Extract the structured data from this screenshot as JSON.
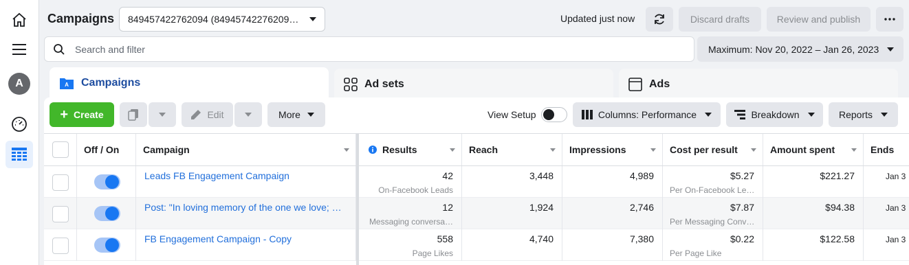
{
  "header": {
    "title": "Campaigns",
    "account_select": "849457422762094 (84945742276209…",
    "updated_status": "Updated just now",
    "discard_label": "Discard drafts",
    "review_label": "Review and publish",
    "more_icon": "ellipsis-icon"
  },
  "search": {
    "placeholder": "Search and filter",
    "icon": "search-icon"
  },
  "date_range": {
    "label": "Maximum: Nov 20, 2022 – Jan 26, 2023"
  },
  "rail": {
    "avatar_letter": "A",
    "icons": [
      "home-icon",
      "menu-icon",
      "avatar",
      "gauge-icon",
      "table-icon"
    ]
  },
  "tabs": [
    {
      "label": "Campaigns",
      "icon": "folder-icon",
      "active": true
    },
    {
      "label": "Ad sets",
      "icon": "grid-icon",
      "active": false
    },
    {
      "label": "Ads",
      "icon": "ad-icon",
      "active": false
    }
  ],
  "toolbar": {
    "create_label": "Create",
    "edit_label": "Edit",
    "more_label": "More",
    "view_setup_label": "View Setup",
    "columns_label": "Columns: Performance",
    "breakdown_label": "Breakdown",
    "reports_label": "Reports"
  },
  "table": {
    "columns": [
      "Off / On",
      "Campaign",
      "Results",
      "Reach",
      "Impressions",
      "Cost per result",
      "Amount spent",
      "Ends"
    ],
    "rows": [
      {
        "name": "Leads FB Engagement Campaign",
        "results": "42",
        "results_sub": "On-Facebook Leads",
        "reach": "3,448",
        "impressions": "4,989",
        "cost": "$5.27",
        "cost_sub": "Per On-Facebook Le…",
        "spent": "$221.27",
        "ends": "Jan 3"
      },
      {
        "name": "Post: \"In loving memory of the one we love; m…",
        "results": "12",
        "results_sub": "Messaging conversa…",
        "reach": "1,924",
        "impressions": "2,746",
        "cost": "$7.87",
        "cost_sub": "Per Messaging Conv…",
        "spent": "$94.38",
        "ends": "Jan 3"
      },
      {
        "name": "FB Engagement Campaign - Copy",
        "results": "558",
        "results_sub": "Page Likes",
        "reach": "4,740",
        "impressions": "7,380",
        "cost": "$0.22",
        "cost_sub": "Per Page Like",
        "spent": "$122.58",
        "ends": "Jan 3"
      }
    ]
  },
  "colors": {
    "accent": "#1877f2",
    "link": "#216fdb",
    "create": "#42b72a",
    "active_tab": "#1e4da0"
  }
}
